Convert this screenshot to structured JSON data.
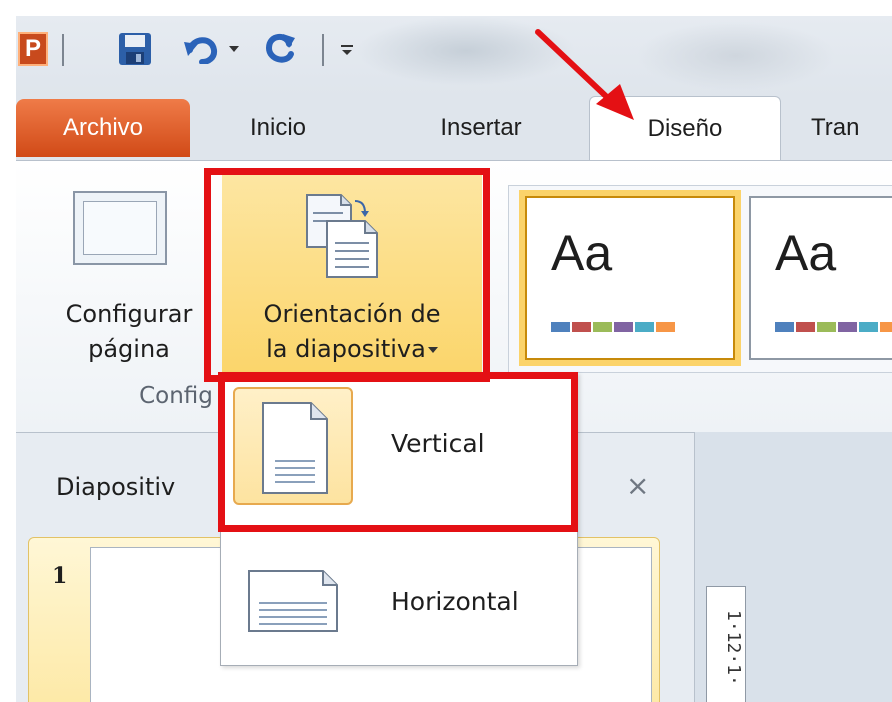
{
  "quick_access": {
    "app_icon_letter": "P",
    "icons": [
      "powerpoint-app-icon",
      "save-icon",
      "undo-icon",
      "redo-icon",
      "customize-toolbar-icon"
    ]
  },
  "tabs": [
    {
      "id": "archivo",
      "label": "Archivo"
    },
    {
      "id": "inicio",
      "label": "Inicio"
    },
    {
      "id": "insertar",
      "label": "Insertar"
    },
    {
      "id": "diseno",
      "label": "Diseño",
      "active": true
    },
    {
      "id": "tran",
      "label": "Tran"
    }
  ],
  "ribbon": {
    "page_setup": {
      "line1": "Configurar",
      "line2": "página"
    },
    "orientation": {
      "line1": "Orientación de",
      "line2": "la diapositiva"
    },
    "group_label": "Config",
    "themes": [
      {
        "label": "Aa",
        "selected": true
      },
      {
        "label": "Aa",
        "selected": false
      }
    ],
    "swatch_colors": [
      "#4f81bd",
      "#c0504d",
      "#9bbb59",
      "#8064a2",
      "#4bacc6",
      "#f79646"
    ]
  },
  "orientation_menu": {
    "items": [
      {
        "label": "Vertical",
        "highlighted": true
      },
      {
        "label": "Horizontal",
        "highlighted": false
      }
    ]
  },
  "slides_pane": {
    "title": "Diapositiv",
    "close_glyph": "×",
    "slide_number": "1"
  },
  "ruler": {
    "text": "1·12·1·"
  },
  "colors": {
    "archivo_tab": "#d14a17",
    "highlight": "#fbd56a",
    "annotation_red": "#e41014"
  }
}
